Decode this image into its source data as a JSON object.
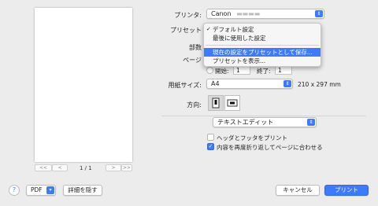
{
  "preview": {
    "page_indicator": "1 / 1",
    "first_label": "<<",
    "prev_label": "<",
    "next_label": ">",
    "last_label": ">>"
  },
  "printer": {
    "label": "プリンタ:",
    "value": "Canon"
  },
  "preset": {
    "label": "プリセット",
    "menu": [
      {
        "label": "デフォルト設定",
        "checked": true
      },
      {
        "label": "最後に使用した設定",
        "checked": false
      },
      {
        "label": "現在の設定をプリセットとして保存...",
        "highlighted": true
      },
      {
        "label": "プリセットを表示...",
        "checked": false
      }
    ]
  },
  "copies": {
    "label": "部数"
  },
  "pages": {
    "label": "ページ",
    "start_label": "開始:",
    "start_value": "1",
    "end_label": "終了:",
    "end_value": "1"
  },
  "paper": {
    "label": "用紙サイズ:",
    "value": "A4",
    "dimensions": "210 x 297 mm"
  },
  "orientation": {
    "label": "方向:"
  },
  "app_section": {
    "value": "テキストエディット"
  },
  "options": {
    "header_footer": {
      "label": "ヘッダとフッタをプリント",
      "checked": false
    },
    "wrap": {
      "label": "内容を再度折り返してページに合わせる",
      "checked": true
    }
  },
  "footer": {
    "help": "?",
    "pdf": "PDF",
    "hide_details": "詳細を隠す",
    "cancel": "キャンセル",
    "print": "プリント"
  },
  "colors": {
    "accent": "#3d7bfa"
  }
}
